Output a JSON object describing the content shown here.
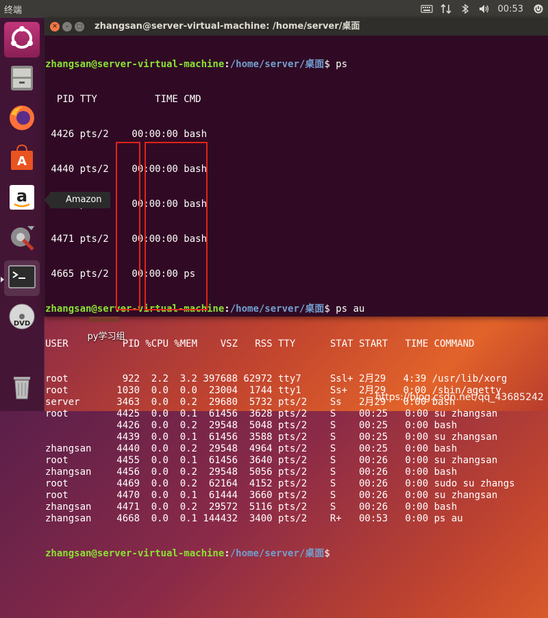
{
  "top_panel": {
    "title": "终端",
    "keyboard_icon": "keyboard-icon",
    "network_icon": "network-icon",
    "bluetooth_icon": "bluetooth-icon",
    "volume_icon": "volume-icon",
    "time": "00:53",
    "power_icon": "power-icon"
  },
  "launcher": {
    "items": [
      {
        "name": "ubuntu-dash",
        "icon": "ubuntu-logo-icon"
      },
      {
        "name": "files",
        "icon": "file-cabinet-icon"
      },
      {
        "name": "firefox",
        "icon": "firefox-icon"
      },
      {
        "name": "software-center",
        "icon": "shopping-bag-icon"
      },
      {
        "name": "amazon",
        "icon": "amazon-icon"
      },
      {
        "name": "system-settings",
        "icon": "settings-icon"
      },
      {
        "name": "terminal",
        "icon": "terminal-icon"
      },
      {
        "name": "dvd",
        "icon": "dvd-icon",
        "label": "DVD"
      },
      {
        "name": "trash",
        "icon": "trash-icon"
      }
    ],
    "tooltip": "Amazon"
  },
  "terminal": {
    "title": "zhangsan@server-virtual-machine: /home/server/桌面",
    "prompt": {
      "user": "zhangsan@server-virtual-machine",
      "colon": ":",
      "path": "/home/server/桌面",
      "dollar": "$"
    },
    "cmd1": " ps",
    "cmd2": " ps au",
    "ps_output": [
      "  PID TTY          TIME CMD",
      " 4426 pts/2    00:00:00 bash",
      " 4440 pts/2    00:00:00 bash",
      " 4456 pts/2    00:00:00 bash",
      " 4471 pts/2    00:00:00 bash",
      " 4665 pts/2    00:00:00 ps"
    ],
    "ps_au_header": {
      "user": "USER",
      "pid": "PID",
      "cpu": "%CPU",
      "mem": "%MEM",
      "rest": "    VSZ   RSS TTY      STAT START   TIME COMMAND"
    },
    "ps_au_rows": [
      {
        "user": "root",
        "pid": "922",
        "cpu": "2.2",
        "mem": "3.2",
        "rest": "397688 62972 tty7     Ssl+ 2月29   4:39 /usr/lib/xorg"
      },
      {
        "user": "root",
        "pid": "1030",
        "cpu": "0.0",
        "mem": "0.0",
        "rest": " 23004  1744 tty1     Ss+  2月29   0:00 /sbin/agetty"
      },
      {
        "user": "server",
        "pid": "3463",
        "cpu": "0.0",
        "mem": "0.2",
        "rest": " 29680  5732 pts/2    Ss   2月29   0:00 bash"
      },
      {
        "user": "root",
        "pid": "4425",
        "cpu": "0.0",
        "mem": "0.1",
        "rest": " 61456  3628 pts/2    S    00:25   0:00 su zhangsan"
      },
      {
        "user": "",
        "pid": "4426",
        "cpu": "0.0",
        "mem": "0.2",
        "rest": " 29548  5048 pts/2    S    00:25   0:00 bash"
      },
      {
        "user": "",
        "pid": "4439",
        "cpu": "0.0",
        "mem": "0.1",
        "rest": " 61456  3588 pts/2    S    00:25   0:00 su zhangsan"
      },
      {
        "user": "zhangsan",
        "pid": "4440",
        "cpu": "0.0",
        "mem": "0.2",
        "rest": " 29548  4964 pts/2    S    00:25   0:00 bash"
      },
      {
        "user": "root",
        "pid": "4455",
        "cpu": "0.0",
        "mem": "0.1",
        "rest": " 61456  3640 pts/2    S    00:26   0:00 su zhangsan"
      },
      {
        "user": "zhangsan",
        "pid": "4456",
        "cpu": "0.0",
        "mem": "0.2",
        "rest": " 29548  5056 pts/2    S    00:26   0:00 bash"
      },
      {
        "user": "root",
        "pid": "4469",
        "cpu": "0.0",
        "mem": "0.2",
        "rest": " 62164  4152 pts/2    S    00:26   0:00 sudo su zhangs"
      },
      {
        "user": "root",
        "pid": "4470",
        "cpu": "0.0",
        "mem": "0.1",
        "rest": " 61444  3660 pts/2    S    00:26   0:00 su zhangsan"
      },
      {
        "user": "zhangsan",
        "pid": "4471",
        "cpu": "0.0",
        "mem": "0.2",
        "rest": " 29572  5116 pts/2    S    00:26   0:00 bash"
      },
      {
        "user": "zhangsan",
        "pid": "4668",
        "cpu": "0.0",
        "mem": "0.1",
        "rest": "144432  3400 pts/2    R+   00:53   0:00 ps au"
      }
    ]
  },
  "desktop": {
    "file_label": "py学习组"
  },
  "watermark": "https://blog.csdn.net/qq_43685242",
  "colors": {
    "terminal_bg": "#300a24",
    "prompt_user": "#8ae234",
    "prompt_path": "#729fcf",
    "highlight_box": "#e2231a"
  }
}
